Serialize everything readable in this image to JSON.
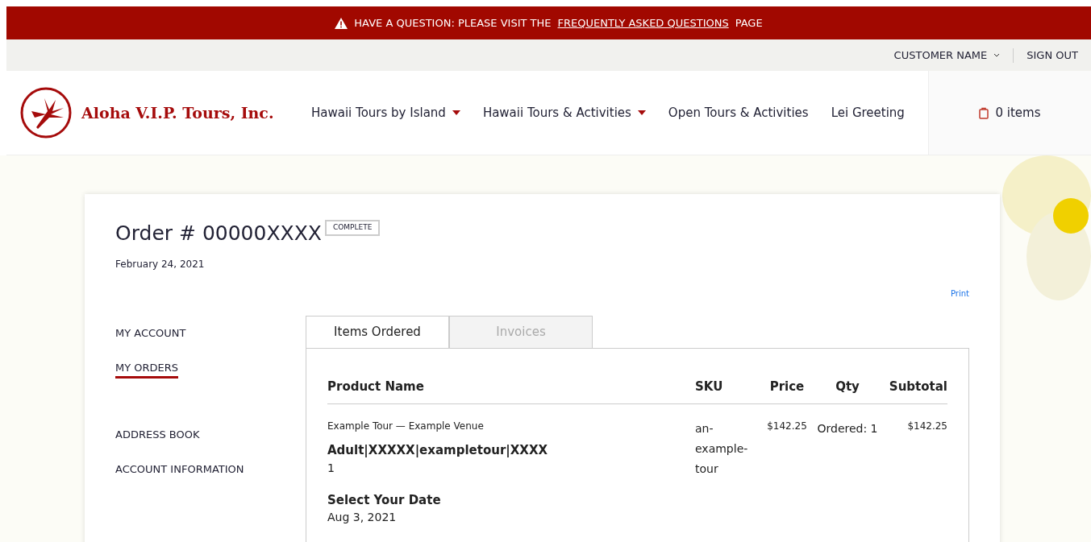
{
  "banner": {
    "text_before": "HAVE A QUESTION: PLEASE VISIT THE",
    "link": "FREQUENTLY ASKED QUESTIONS",
    "text_after": "PAGE"
  },
  "account_bar": {
    "customer": "CUSTOMER NAME",
    "sign_out": "SIGN OUT"
  },
  "header": {
    "logo": "Aloha V.I.P. Tours, Inc.",
    "nav": [
      {
        "label": "Hawaii Tours by Island",
        "dropdown": true
      },
      {
        "label": "Hawaii Tours & Activities",
        "dropdown": true
      },
      {
        "label": "Open Tours & Activities",
        "dropdown": false
      },
      {
        "label": "Lei Greeting",
        "dropdown": false
      }
    ],
    "cart": "0 items"
  },
  "order": {
    "title": "Order # 00000XXXX",
    "status": "COMPLETE",
    "date": "February 24, 2021",
    "print": "Print"
  },
  "sidebar": {
    "items": [
      {
        "label": "MY ACCOUNT",
        "selected": false
      },
      {
        "label": "MY ORDERS",
        "selected": true
      },
      {
        "label": "ADDRESS BOOK",
        "selected": false
      },
      {
        "label": "ACCOUNT INFORMATION",
        "selected": false
      }
    ]
  },
  "tabs": [
    {
      "label": "Items Ordered",
      "selected": true
    },
    {
      "label": "Invoices",
      "selected": false
    }
  ],
  "table": {
    "columns": [
      "Product Name",
      "SKU",
      "Price",
      "Qty",
      "Subtotal"
    ],
    "rows": [
      {
        "product": "Example Tour — Example Venue",
        "option": "Adult|XXXXX|exampletour|XXXX",
        "option_value": "1",
        "date_label": "Select Your Date",
        "date_value": "Aug 3, 2021",
        "sku": "an-example-tour",
        "price": "$142.25",
        "qty": "Ordered: 1",
        "subtotal": "$142.25"
      }
    ]
  }
}
